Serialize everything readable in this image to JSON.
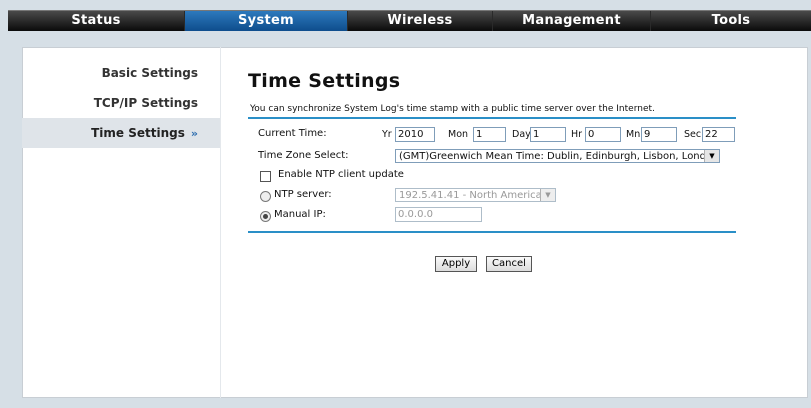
{
  "nav": {
    "tabs": [
      {
        "label": "Status"
      },
      {
        "label": "System"
      },
      {
        "label": "Wireless"
      },
      {
        "label": "Management"
      },
      {
        "label": "Tools"
      }
    ],
    "active": "System"
  },
  "sidebar": {
    "items": [
      {
        "label": "Basic Settings"
      },
      {
        "label": "TCP/IP Settings"
      },
      {
        "label": "Time Settings",
        "marker": "»"
      }
    ]
  },
  "page": {
    "title": "Time Settings",
    "description": "You can synchronize System Log's time stamp with a public time server over the Internet."
  },
  "current_time": {
    "label": "Current Time:",
    "yr_label": "Yr",
    "yr": "2010",
    "mon_label": "Mon",
    "mon": "1",
    "day_label": "Day",
    "day": "1",
    "hr_label": "Hr",
    "hr": "0",
    "mn_label": "Mn",
    "mn": "9",
    "sec_label": "Sec",
    "sec": "22"
  },
  "timezone": {
    "label": "Time Zone Select:",
    "value": "(GMT)Greenwich Mean Time: Dublin, Edinburgh, Lisbon, London"
  },
  "ntp": {
    "enable_label": "Enable NTP client update",
    "server_label": "NTP server:",
    "server_value": "192.5.41.41 - North America",
    "manual_label": "Manual IP:",
    "manual_value": "0.0.0.0"
  },
  "buttons": {
    "apply": "Apply",
    "cancel": "Cancel"
  },
  "colors": {
    "tab_bar": "#111111",
    "active_tab": "#1e64a8",
    "accent_line": "#2a8fc7",
    "frame_bg": "#d6dfe6"
  }
}
